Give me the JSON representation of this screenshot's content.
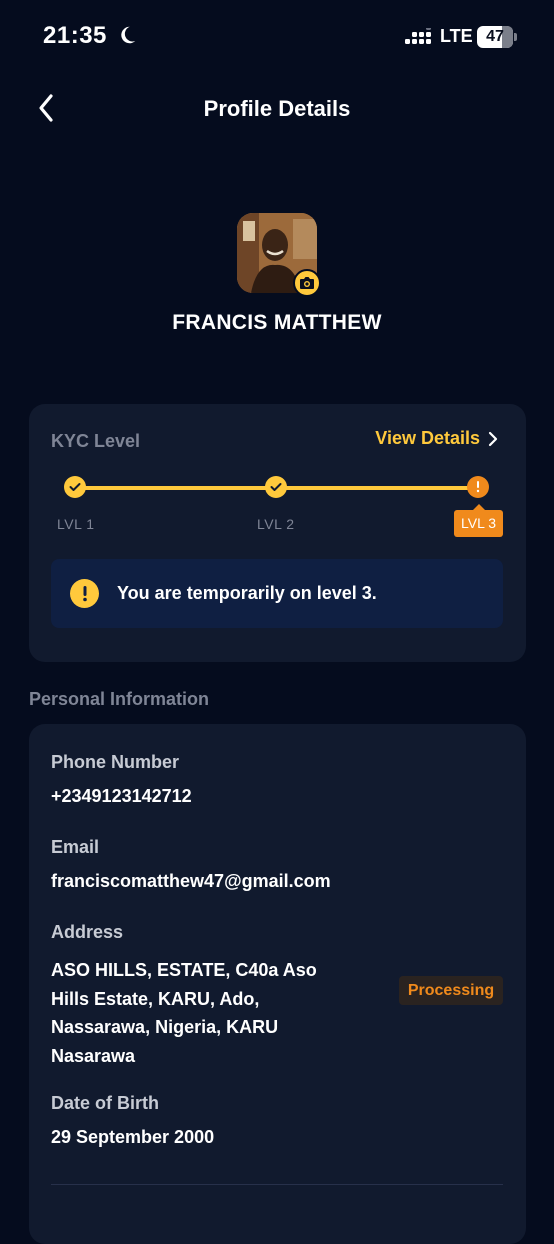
{
  "status_bar": {
    "time": "21:35",
    "network": "LTE",
    "battery": "47",
    "icons": [
      "moon-icon",
      "signal-icon",
      "battery-icon"
    ]
  },
  "header": {
    "title": "Profile Details",
    "back_icon": "chevron-left-icon"
  },
  "profile": {
    "name": "FRANCIS MATTHEW",
    "camera_icon": "camera-icon"
  },
  "kyc": {
    "title": "KYC Level",
    "view_details_label": "View Details",
    "levels": [
      "LVL 1",
      "LVL 2",
      "LVL 3"
    ],
    "current_level_index": 2,
    "notice": "You are temporarily on level 3.",
    "accent_color": "#ffc93c",
    "current_color": "#f08a1c"
  },
  "personal_info": {
    "section_title": "Personal Information",
    "phone_label": "Phone Number",
    "phone_value": "+2349123142712",
    "email_label": "Email",
    "email_value": "franciscomatthew47@gmail.com",
    "address_label": "Address",
    "address_value": "ASO HILLS, ESTATE, C40a Aso Hills Estate, KARU, Ado, Nassarawa, Nigeria, KARU Nasarawa",
    "address_status": "Processing",
    "dob_label": "Date of Birth",
    "dob_value": "29 September 2000"
  }
}
